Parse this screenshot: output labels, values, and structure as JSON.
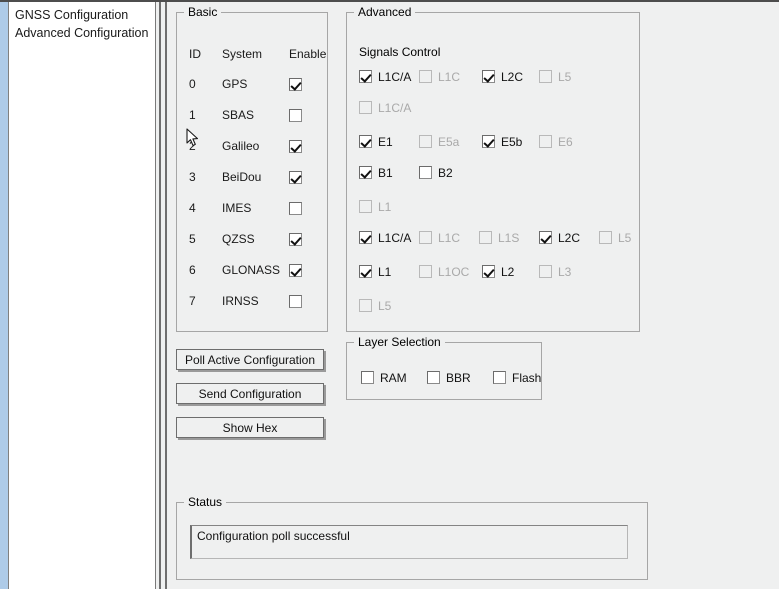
{
  "sidebar": {
    "items": [
      {
        "label": "GNSS Configuration"
      },
      {
        "label": "Advanced Configuration"
      }
    ]
  },
  "basic": {
    "legend": "Basic",
    "headers": {
      "id": "ID",
      "system": "System",
      "enable": "Enable"
    },
    "rows": [
      {
        "id": "0",
        "system": "GPS",
        "enabled": true
      },
      {
        "id": "1",
        "system": "SBAS",
        "enabled": false
      },
      {
        "id": "2",
        "system": "Galileo",
        "enabled": true
      },
      {
        "id": "3",
        "system": "BeiDou",
        "enabled": true
      },
      {
        "id": "4",
        "system": "IMES",
        "enabled": false
      },
      {
        "id": "5",
        "system": "QZSS",
        "enabled": true
      },
      {
        "id": "6",
        "system": "GLONASS",
        "enabled": true
      },
      {
        "id": "7",
        "system": "IRNSS",
        "enabled": false
      }
    ]
  },
  "advanced": {
    "legend": "Advanced",
    "signals_title": "Signals Control",
    "rows": [
      {
        "items": [
          {
            "label": "L1C/A",
            "checked": true,
            "disabled": false
          },
          {
            "label": "L1C",
            "checked": false,
            "disabled": true
          },
          {
            "label": "L2C",
            "checked": true,
            "disabled": false
          },
          {
            "label": "L5",
            "checked": false,
            "disabled": true
          }
        ]
      },
      {
        "items": [
          {
            "label": "L1C/A",
            "checked": false,
            "disabled": true
          }
        ]
      },
      {
        "items": [
          {
            "label": "E1",
            "checked": true,
            "disabled": false
          },
          {
            "label": "E5a",
            "checked": false,
            "disabled": true
          },
          {
            "label": "E5b",
            "checked": true,
            "disabled": false
          },
          {
            "label": "E6",
            "checked": false,
            "disabled": true
          }
        ]
      },
      {
        "items": [
          {
            "label": "B1",
            "checked": true,
            "disabled": false
          },
          {
            "label": "B2",
            "checked": false,
            "disabled": false
          }
        ]
      },
      {
        "items": [
          {
            "label": "L1",
            "checked": false,
            "disabled": true
          }
        ]
      },
      {
        "items": [
          {
            "label": "L1C/A",
            "checked": true,
            "disabled": false
          },
          {
            "label": "L1C",
            "checked": false,
            "disabled": true
          },
          {
            "label": "L1S",
            "checked": false,
            "disabled": true
          },
          {
            "label": "L2C",
            "checked": true,
            "disabled": false
          },
          {
            "label": "L5",
            "checked": false,
            "disabled": true
          }
        ]
      },
      {
        "items": [
          {
            "label": "L1",
            "checked": true,
            "disabled": false
          },
          {
            "label": "L1OC",
            "checked": false,
            "disabled": true
          },
          {
            "label": "L2",
            "checked": true,
            "disabled": false
          },
          {
            "label": "L3",
            "checked": false,
            "disabled": true
          }
        ]
      },
      {
        "items": [
          {
            "label": "L5",
            "checked": false,
            "disabled": true
          }
        ]
      }
    ]
  },
  "buttons": {
    "poll": "Poll Active Configuration",
    "send": "Send Configuration",
    "hex": "Show Hex"
  },
  "layer": {
    "legend": "Layer Selection",
    "items": [
      {
        "label": "RAM",
        "checked": false,
        "disabled": false
      },
      {
        "label": "BBR",
        "checked": false,
        "disabled": false
      },
      {
        "label": "Flash",
        "checked": false,
        "disabled": false
      }
    ]
  },
  "status": {
    "legend": "Status",
    "message": "Configuration poll successful"
  },
  "cursor": {
    "icon": "arrow-pointer-icon"
  },
  "colors": {
    "window_bg": "#eff0f0",
    "sidebar_bg": "#ffffff",
    "accent_edge": "#aecbe8",
    "group_border": "#a6a6a6",
    "disabled_text": "#a9a9a9"
  }
}
